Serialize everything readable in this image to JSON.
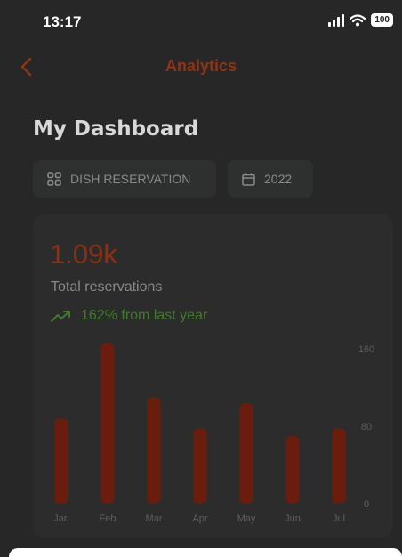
{
  "status_bar": {
    "time": "13:17",
    "battery": "100"
  },
  "nav": {
    "title": "Analytics",
    "back_icon": "chevron-left-icon"
  },
  "dashboard": {
    "title": "My Dashboard",
    "filters": {
      "dish": {
        "label": "DISH RESERVATION",
        "icon": "grid-icon"
      },
      "year": {
        "label": "2022",
        "icon": "calendar-icon"
      }
    }
  },
  "summary": {
    "value": "1.09k",
    "label": "Total reservations",
    "growth": "162% from last year",
    "growth_icon": "trending-up-icon"
  },
  "colors": {
    "accent": "#8f3416",
    "bar": "#6b1d0d",
    "growth": "#3f7a2d"
  },
  "chart_data": {
    "type": "bar",
    "categories": [
      "Jan",
      "Feb",
      "Mar",
      "Apr",
      "May",
      "Jun",
      "Jul"
    ],
    "values": [
      88,
      166,
      110,
      78,
      104,
      70,
      78
    ],
    "ylim": [
      0,
      160
    ],
    "yticks": [
      "0",
      "80",
      "160"
    ],
    "grid": false,
    "y_axis_position": "right"
  }
}
